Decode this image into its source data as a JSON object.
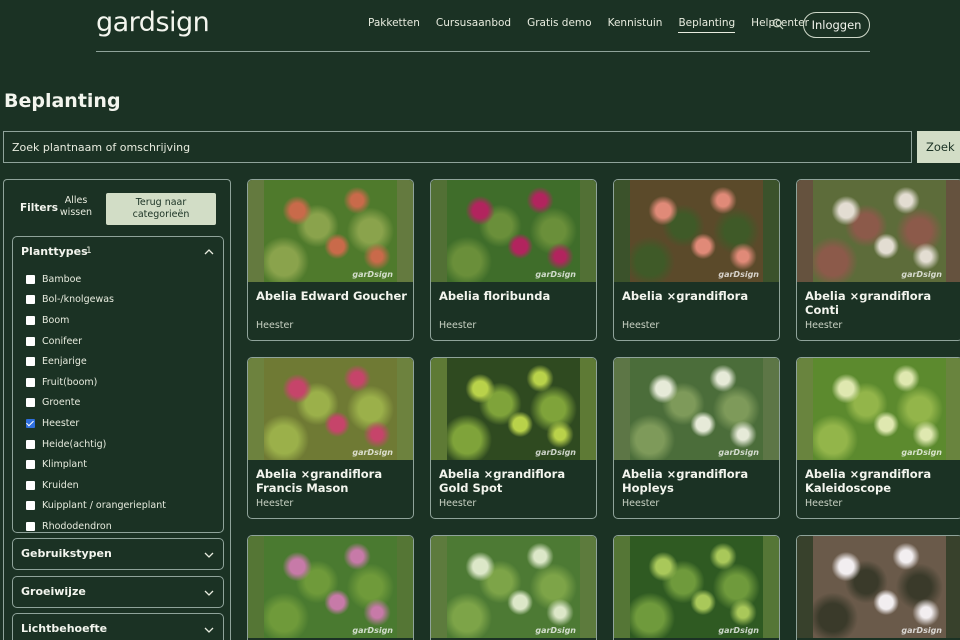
{
  "header": {
    "logo": "gardsign",
    "nav": [
      "Pakketten",
      "Cursusaanbod",
      "Gratis demo",
      "Kennistuin",
      "Beplanting",
      "Helpcenter"
    ],
    "active_nav": "Beplanting",
    "login_label": "Inloggen"
  },
  "page_title": "Beplanting",
  "search": {
    "placeholder": "Zoek plantnaam of omschrijving",
    "button_label": "Zoek"
  },
  "filters": {
    "label": "Filters",
    "clear_label": "Alles wissen",
    "back_label": "Terug naar categorieën",
    "open_panel": {
      "title": "Planttypes",
      "count": "1",
      "options": [
        {
          "label": "Bamboe",
          "checked": false
        },
        {
          "label": "Bol-/knolgewas",
          "checked": false
        },
        {
          "label": "Boom",
          "checked": false
        },
        {
          "label": "Conifeer",
          "checked": false
        },
        {
          "label": "Eenjarige",
          "checked": false
        },
        {
          "label": "Fruit(boom)",
          "checked": false
        },
        {
          "label": "Groente",
          "checked": false
        },
        {
          "label": "Heester",
          "checked": true
        },
        {
          "label": "Heide(achtig)",
          "checked": false
        },
        {
          "label": "Klimplant",
          "checked": false
        },
        {
          "label": "Kruiden",
          "checked": false
        },
        {
          "label": "Kuipplant / orangerieplant",
          "checked": false
        },
        {
          "label": "Rhododendron",
          "checked": false
        }
      ]
    },
    "closed_panels": [
      "Gebruikstypen",
      "Groeiwijze",
      "Lichtbehoefte"
    ]
  },
  "watermark": "garDsign",
  "plants": [
    {
      "name": "Abelia Edward Goucher",
      "type": "Heester",
      "colors": [
        "#4f7a2c",
        "#c96a4a",
        "#8aa34c"
      ]
    },
    {
      "name": "Abelia floribunda",
      "type": "Heester",
      "colors": [
        "#3f6d2a",
        "#b2245e",
        "#6a8f3a"
      ]
    },
    {
      "name": "Abelia ×grandiflora",
      "type": "Heester",
      "colors": [
        "#5b4a2a",
        "#e08a78",
        "#3f5a28"
      ]
    },
    {
      "name": "Abelia ×grandiflora Conti",
      "type": "Heester",
      "colors": [
        "#5d6c3a",
        "#e3ddd2",
        "#8c5a4a"
      ]
    },
    {
      "name": "Abelia ×grandiflora Francis Mason",
      "type": "Heester",
      "colors": [
        "#6f7a34",
        "#c6446a",
        "#9bb04a"
      ]
    },
    {
      "name": "Abelia ×grandiflora Gold Spot",
      "type": "Heester",
      "colors": [
        "#2f4a20",
        "#b9d24a",
        "#7fa33a"
      ]
    },
    {
      "name": "Abelia ×grandiflora Hopleys",
      "type": "Heester",
      "colors": [
        "#4b6d3a",
        "#e6ead8",
        "#7e9a5a"
      ]
    },
    {
      "name": "Abelia ×grandiflora Kaleidoscope",
      "type": "Heester",
      "colors": [
        "#5c8a2e",
        "#dfe8b0",
        "#93b54a"
      ]
    },
    {
      "name": "",
      "type": "",
      "colors": [
        "#4a7a30",
        "#c77aa8",
        "#6f9a3a"
      ]
    },
    {
      "name": "",
      "type": "",
      "colors": [
        "#4d7a34",
        "#dce7c8",
        "#7da448"
      ]
    },
    {
      "name": "",
      "type": "",
      "colors": [
        "#2f5a22",
        "#a9c85a",
        "#6f9a3c"
      ]
    },
    {
      "name": "",
      "type": "",
      "colors": [
        "#6a5a4a",
        "#f2eef0",
        "#3a3a2a"
      ]
    }
  ]
}
